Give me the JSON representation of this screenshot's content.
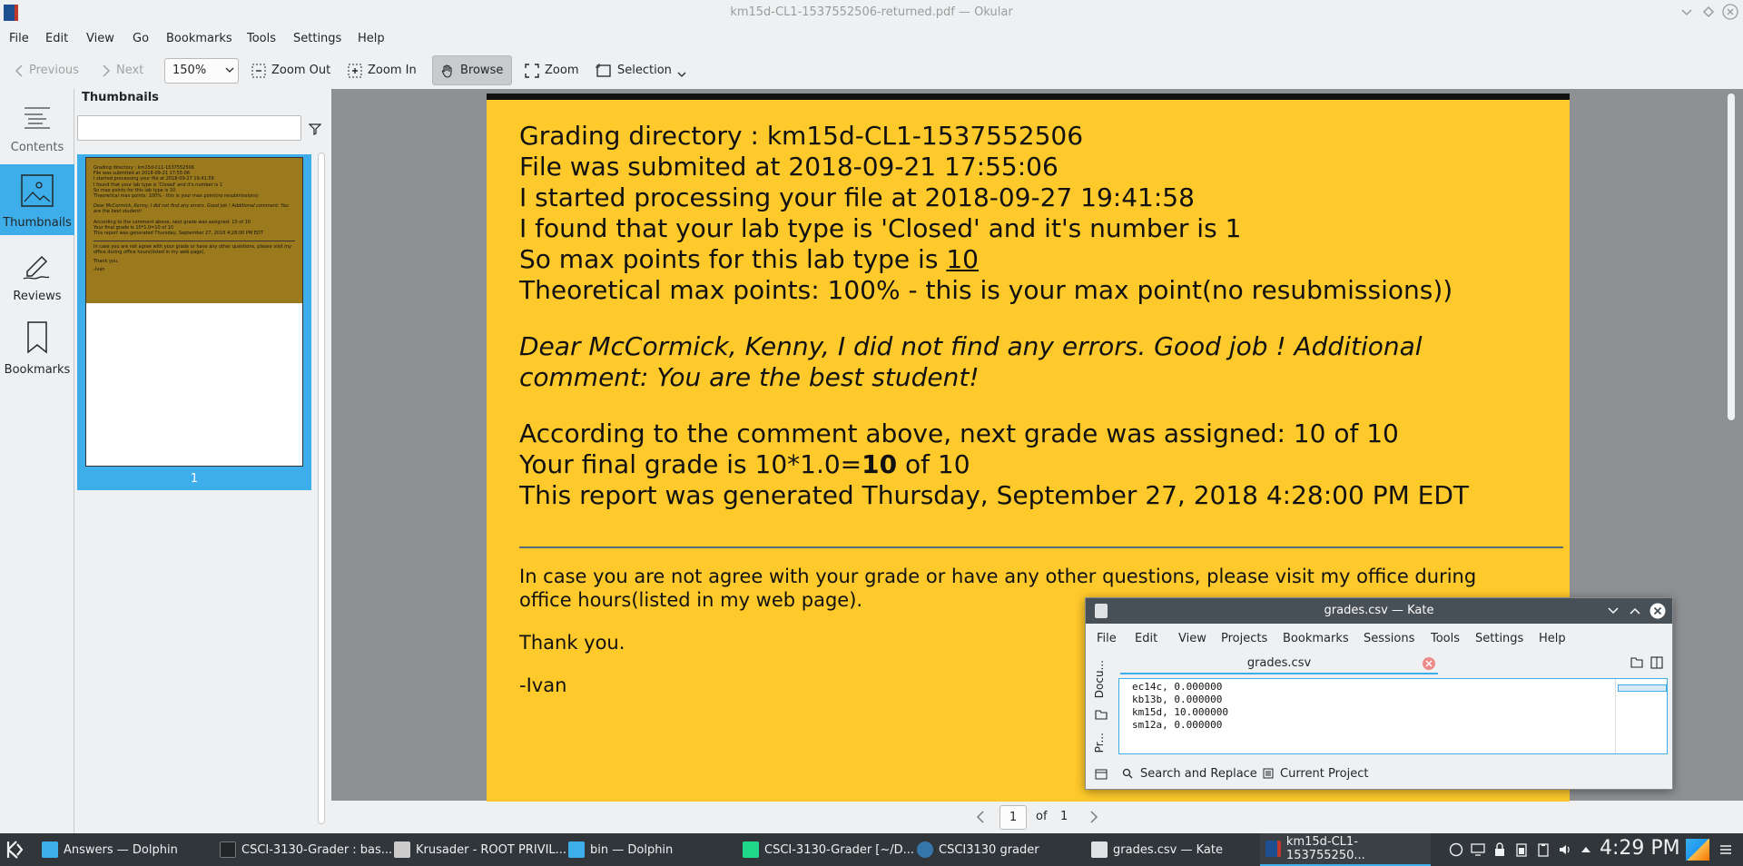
{
  "window": {
    "title": "km15d-CL1-1537552506-returned.pdf — Okular"
  },
  "menu": [
    "File",
    "Edit",
    "View",
    "Go",
    "Bookmarks",
    "Tools",
    "Settings",
    "Help"
  ],
  "toolbar": {
    "previous": "Previous",
    "next": "Next",
    "zoom_value": "150%",
    "zoom_out": "Zoom Out",
    "zoom_in": "Zoom In",
    "browse": "Browse",
    "zoom": "Zoom",
    "selection": "Selection"
  },
  "sidebar": {
    "items": [
      "Contents",
      "Thumbnails",
      "Reviews",
      "Bookmarks"
    ]
  },
  "thumbnails": {
    "header": "Thumbnails",
    "page_number": "1"
  },
  "document": {
    "line1": "Grading directory : km15d-CL1-1537552506",
    "line2": "File was submited at 2018-09-21 17:55:06",
    "line3": "I started processing your file at 2018-09-27 19:41:58",
    "line4": "I found that your lab type is 'Closed' and it's number is 1",
    "line5_prefix": "So max points for this lab type is ",
    "line5_value": "10",
    "line6": "Theoretical max points: 100% - this is your max point(no resubmissions))",
    "comment1": "Dear McCormick, Kenny, I did not find any errors. Good job ! Additional",
    "comment2": "comment: You are the best student!",
    "grade1": "According to the comment above, next grade was assigned: 10 of 10",
    "grade2_prefix": "Your final grade is 10*1.0=",
    "grade2_bold": "10",
    "grade2_suffix": " of 10",
    "grade3": "This report was generated Thursday, September 27, 2018 4:28:00 PM EDT",
    "note1": "In case you are not agree with your grade or have any other questions, please visit my office during",
    "note2": "office hours(listed in my web page).",
    "thanks": "Thank you.",
    "sign": "-Ivan"
  },
  "pagenav": {
    "current": "1",
    "of_label": "of",
    "total": "1"
  },
  "kate": {
    "title": "grades.csv — Kate",
    "menu": [
      "File",
      "Edit",
      "View",
      "Projects",
      "Bookmarks",
      "Sessions",
      "Tools",
      "Settings",
      "Help"
    ],
    "tab": "grades.csv",
    "side_docs": "Docu...",
    "side_pr": "Pr...",
    "lines": [
      "ec14c, 0.000000",
      "kb13b, 0.000000",
      "km15d, 10.000000",
      "sm12a, 0.000000"
    ],
    "search_replace": "Search and Replace",
    "current_project": "Current Project"
  },
  "taskbar": {
    "tasks": [
      "Answers — Dolphin",
      "CSCI-3130-Grader : bas...",
      "Krusader - ROOT PRIVIL...",
      "bin — Dolphin",
      "CSCI-3130-Grader [~/D...",
      "CSCI3130 grader",
      "grades.csv — Kate",
      "km15d-CL1-153755250..."
    ],
    "clock": "4:29 PM"
  },
  "colors": {
    "accent": "#3daee9",
    "page_bg": "#fec92b",
    "taskbar": "#31363b"
  }
}
